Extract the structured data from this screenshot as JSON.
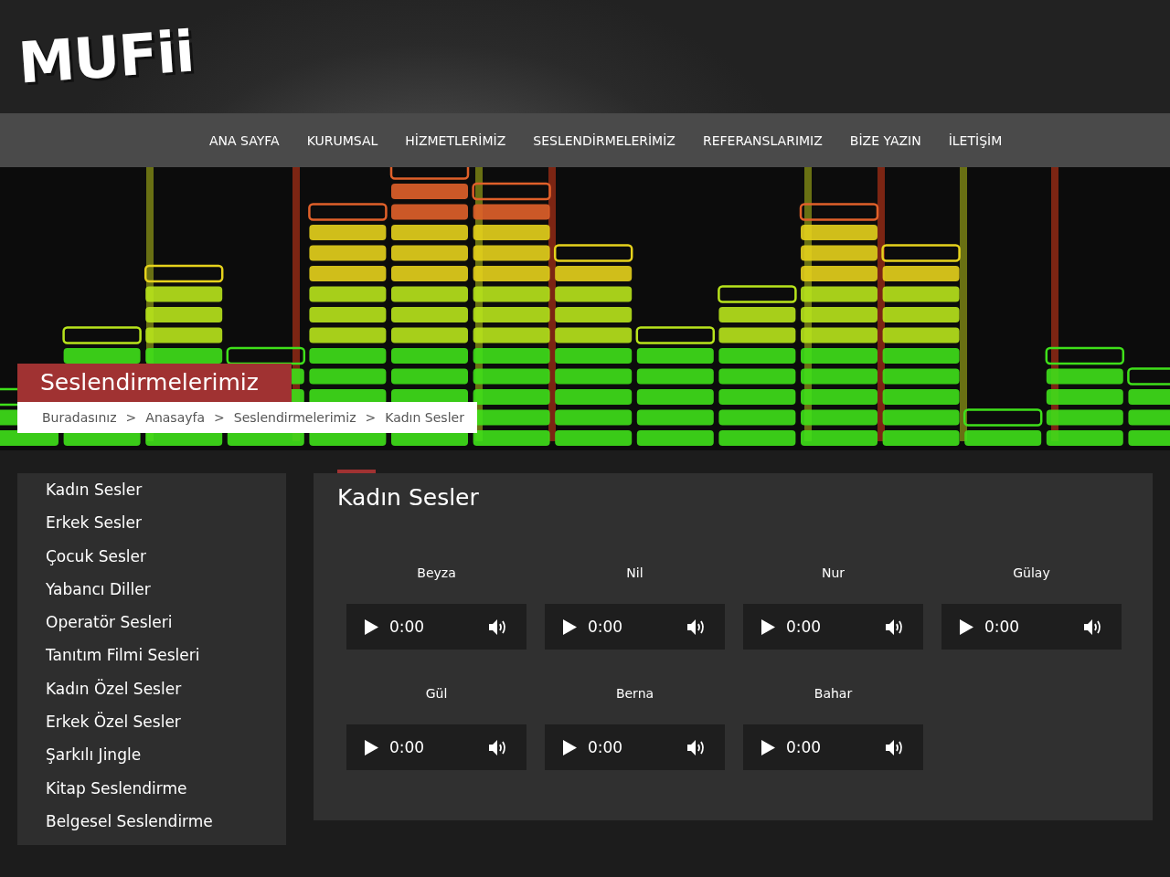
{
  "logo": {
    "text": "MUFii"
  },
  "nav": {
    "items": [
      "ANA SAYFA",
      "KURUMSAL",
      "HİZMETLERİMİZ",
      "SESLENDİRMELERİMİZ",
      "REFERANSLARIMIZ",
      "BİZE YAZIN",
      "İLETİŞİM"
    ]
  },
  "page_title": "Seslendirmelerimiz",
  "breadcrumb": {
    "items": [
      "Buradasınız",
      "Anasayfa",
      "Seslendirmelerimiz",
      "Kadın Sesler"
    ],
    "separators": [
      ">",
      ">",
      ">"
    ]
  },
  "sidebar": {
    "items": [
      "Kadın Sesler",
      "Erkek Sesler",
      "Çocuk Sesler",
      "Yabancı Diller",
      "Operatör Sesleri",
      "Tanıtım Filmi Sesleri",
      "Kadın Özel Sesler",
      "Erkek Özel Sesler",
      "Şarkılı Jingle",
      "Kitap Seslendirme",
      "Belgesel Seslendirme"
    ]
  },
  "content": {
    "title": "Kadın Sesler",
    "players": [
      {
        "name": "Beyza",
        "time": "0:00"
      },
      {
        "name": "Nil",
        "time": "0:00"
      },
      {
        "name": "Nur",
        "time": "0:00"
      },
      {
        "name": "Gülay",
        "time": "0:00"
      },
      {
        "name": "Gül",
        "time": "0:00"
      },
      {
        "name": "Berna",
        "time": "0:00"
      },
      {
        "name": "Bahar",
        "time": "0:00"
      }
    ]
  }
}
